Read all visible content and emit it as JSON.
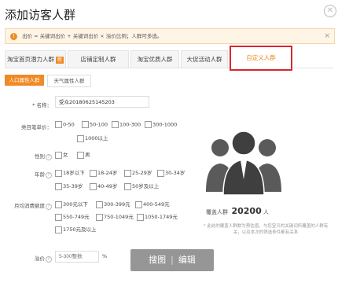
{
  "dialog": {
    "title": "添加访客人群",
    "close_icon": "close-icon"
  },
  "notice": {
    "icon": "info-icon",
    "text": "出价 = 关键词出价 + 关键词出价 × 溢价比例；人群可多选。",
    "close": "×"
  },
  "tabs": [
    {
      "label": "淘宝首页潜力人群",
      "badge": "新"
    },
    {
      "label": "店铺定制人群"
    },
    {
      "label": "淘宝优质人群"
    },
    {
      "label": "大促活动人群"
    },
    {
      "label": "自定义人群"
    }
  ],
  "subtabs": [
    "人口属性人群",
    "天气属性人群"
  ],
  "form": {
    "name_label": "* 名称：",
    "name_value": "受众20180625145203",
    "category_label": "类目笔单价：",
    "category_options": [
      "0-50",
      "50-100",
      "100-300",
      "300-1000",
      "1000以上"
    ],
    "gender_label": "性别",
    "gender_options": [
      "女",
      "男"
    ],
    "age_label": "年龄",
    "age_options": [
      "18岁以下",
      "18-24岁",
      "25-29岁",
      "30-34岁",
      "35-39岁",
      "40-49岁",
      "50岁及以上"
    ],
    "spend_label": "月均消费额度",
    "spend_options": [
      "300元以下",
      "300-399元",
      "400-549元",
      "550-749元",
      "750-1049元",
      "1050-1749元",
      "1750元及以上"
    ],
    "premium_label": "溢价",
    "premium_placeholder": "5-300整数",
    "premium_unit": "%"
  },
  "preview": {
    "icon": "people-group-icon",
    "cover_label": "覆盖人群",
    "cover_value": "20200",
    "cover_unit": "人",
    "note": "* 此处的覆盖人群数为预估值，与您宝贝的关键词所覆盖的人群有关，以及本次的筛选条件都有关系"
  },
  "watermark": {
    "left": "搜图",
    "right": "编辑"
  },
  "colors": {
    "accent": "#f08a24",
    "highlight": "#d9272e"
  }
}
